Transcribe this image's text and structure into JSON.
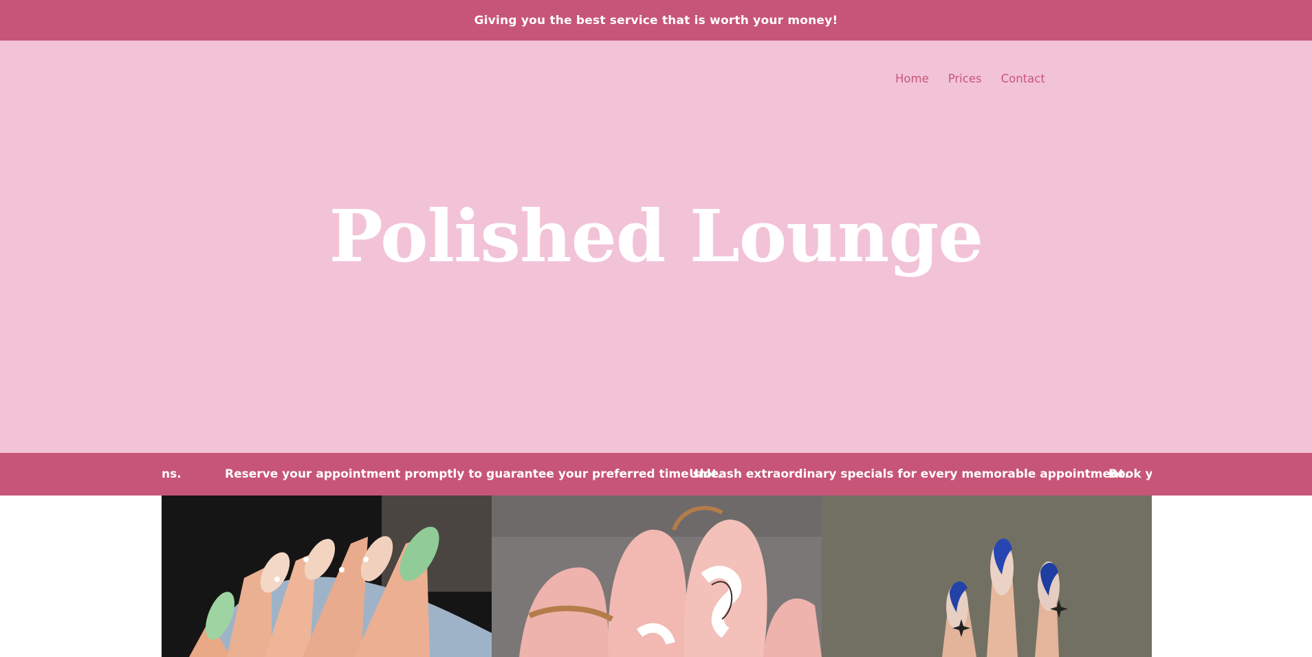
{
  "announcement": "Giving you the best service that is worth your money!",
  "nav": {
    "items": [
      "Home",
      "Prices",
      "Contact"
    ]
  },
  "hero": {
    "title": "Polished Lounge"
  },
  "ticker": {
    "items": [
      "ns.",
      "Reserve your appointment promptly to guarantee your preferred time slot.",
      "Unleash extraordinary specials for every memorable appointment.",
      "Book yo"
    ]
  },
  "gallery": {
    "tiles": [
      {
        "subject": "green-floral-nails-photo"
      },
      {
        "subject": "pink-swirl-nails-photo"
      },
      {
        "subject": "blue-tip-nails-photo"
      }
    ]
  },
  "colors": {
    "accent": "#c75577",
    "hero_bg": "#f2c3d7",
    "text_light": "#ffffff"
  }
}
